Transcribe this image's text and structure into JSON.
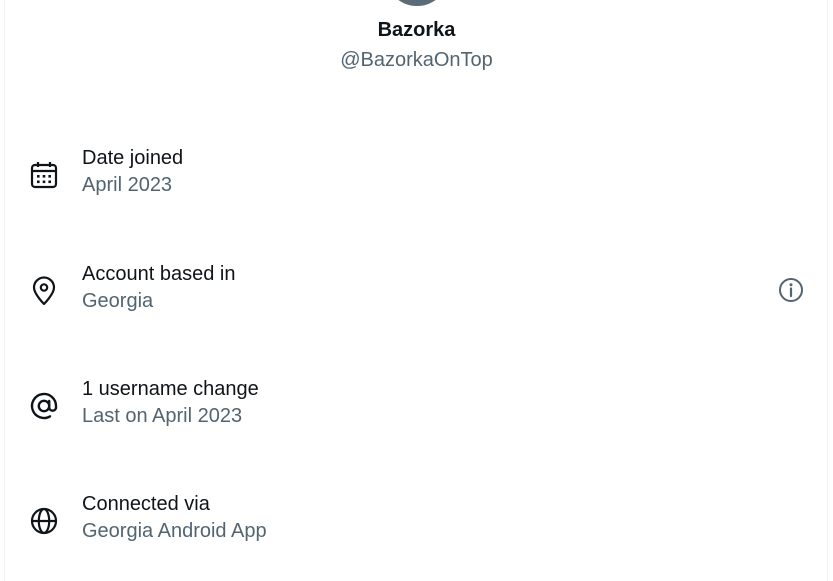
{
  "profile": {
    "display_name": "Bazorka",
    "handle": "@BazorkaOnTop"
  },
  "rows": [
    {
      "icon": "calendar-icon",
      "title": "Date joined",
      "subtitle": "April 2023"
    },
    {
      "icon": "location-pin-icon",
      "title": "Account based in",
      "subtitle": "Georgia",
      "action_icon": "info-icon"
    },
    {
      "icon": "at-sign-icon",
      "title": "1 username change",
      "subtitle": "Last on April 2023"
    },
    {
      "icon": "globe-icon",
      "title": "Connected via",
      "subtitle": "Georgia Android App"
    }
  ],
  "colors": {
    "primary_text": "#0f1419",
    "secondary_text": "#536471",
    "avatar": "#5b6b78",
    "border": "#eff3f4"
  }
}
